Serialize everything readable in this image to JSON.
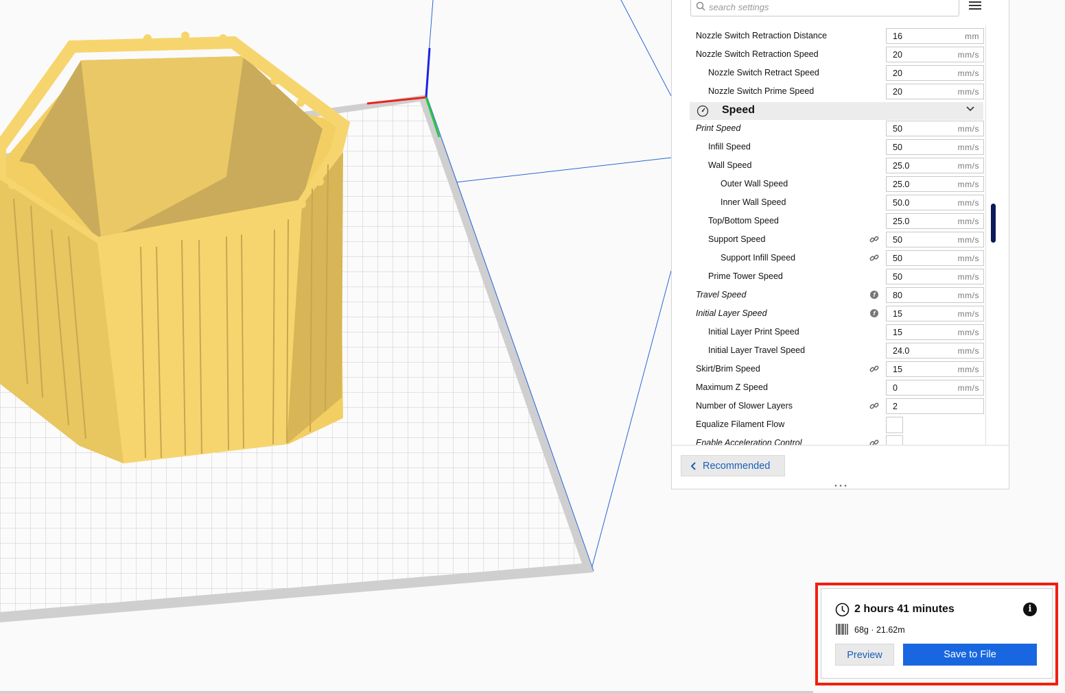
{
  "search": {
    "placeholder": "search settings"
  },
  "settings": [
    {
      "label": "Nozzle Switch Retraction Distance",
      "value": "16",
      "unit": "mm",
      "indent": 0
    },
    {
      "label": "Nozzle Switch Retraction Speed",
      "value": "20",
      "unit": "mm/s",
      "indent": 0
    },
    {
      "label": "Nozzle Switch Retract Speed",
      "value": "20",
      "unit": "mm/s",
      "indent": 1
    },
    {
      "label": "Nozzle Switch Prime Speed",
      "value": "20",
      "unit": "mm/s",
      "indent": 1
    }
  ],
  "speed_category": {
    "label": "Speed",
    "icon": "speedometer-icon"
  },
  "speed_settings": [
    {
      "label": "Print Speed",
      "value": "50",
      "unit": "mm/s",
      "indent": 0,
      "italic": true,
      "marker": ""
    },
    {
      "label": "Infill Speed",
      "value": "50",
      "unit": "mm/s",
      "indent": 1,
      "italic": false,
      "marker": ""
    },
    {
      "label": "Wall Speed",
      "value": "25.0",
      "unit": "mm/s",
      "indent": 1,
      "italic": false,
      "marker": ""
    },
    {
      "label": "Outer Wall Speed",
      "value": "25.0",
      "unit": "mm/s",
      "indent": 2,
      "italic": false,
      "marker": ""
    },
    {
      "label": "Inner Wall Speed",
      "value": "50.0",
      "unit": "mm/s",
      "indent": 2,
      "italic": false,
      "marker": ""
    },
    {
      "label": "Top/Bottom Speed",
      "value": "25.0",
      "unit": "mm/s",
      "indent": 1,
      "italic": false,
      "marker": ""
    },
    {
      "label": "Support Speed",
      "value": "50",
      "unit": "mm/s",
      "indent": 1,
      "italic": false,
      "marker": "link"
    },
    {
      "label": "Support Infill Speed",
      "value": "50",
      "unit": "mm/s",
      "indent": 2,
      "italic": false,
      "marker": "link"
    },
    {
      "label": "Prime Tower Speed",
      "value": "50",
      "unit": "mm/s",
      "indent": 1,
      "italic": false,
      "marker": ""
    },
    {
      "label": "Travel Speed",
      "value": "80",
      "unit": "mm/s",
      "indent": 0,
      "italic": true,
      "marker": "function"
    },
    {
      "label": "Initial Layer Speed",
      "value": "15",
      "unit": "mm/s",
      "indent": 0,
      "italic": true,
      "marker": "function"
    },
    {
      "label": "Initial Layer Print Speed",
      "value": "15",
      "unit": "mm/s",
      "indent": 1,
      "italic": false,
      "marker": ""
    },
    {
      "label": "Initial Layer Travel Speed",
      "value": "24.0",
      "unit": "mm/s",
      "indent": 1,
      "italic": false,
      "marker": ""
    },
    {
      "label": "Skirt/Brim Speed",
      "value": "15",
      "unit": "mm/s",
      "indent": 0,
      "italic": false,
      "marker": "link"
    },
    {
      "label": "Maximum Z Speed",
      "value": "0",
      "unit": "mm/s",
      "indent": 0,
      "italic": false,
      "marker": ""
    },
    {
      "label": "Number of Slower Layers",
      "value": "2",
      "unit": "",
      "indent": 0,
      "italic": false,
      "marker": "link"
    },
    {
      "label": "Equalize Filament Flow",
      "value": "",
      "unit": "",
      "indent": 0,
      "italic": false,
      "marker": "",
      "checkbox": true
    },
    {
      "label": "Enable Acceleration Control",
      "value": "",
      "unit": "",
      "indent": 0,
      "italic": true,
      "marker": "link",
      "checkbox": true
    }
  ],
  "recommended_button": "Recommended",
  "print_summary": {
    "time": "2 hours 41 minutes",
    "material": "68g · 21.62m",
    "preview_label": "Preview",
    "save_label": "Save to File"
  },
  "colors": {
    "model": "#f7d56e",
    "accent": "#1967e0",
    "highlight_border": "#f21e10",
    "axis_x": "#e8241c",
    "axis_y": "#27c93f",
    "axis_z": "#1a22e6"
  }
}
